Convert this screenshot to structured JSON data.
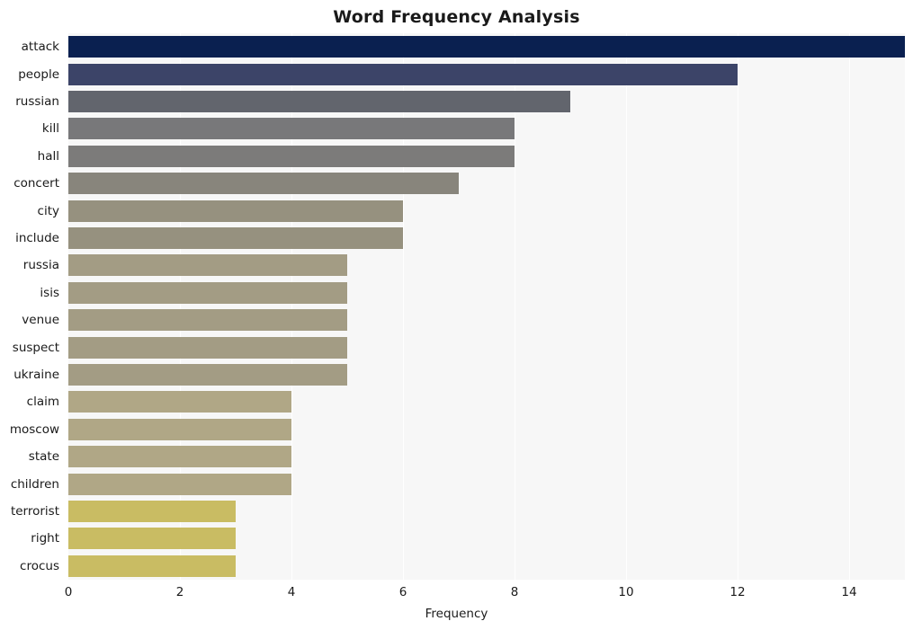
{
  "chart_data": {
    "type": "bar",
    "orientation": "horizontal",
    "title": "Word Frequency Analysis",
    "xlabel": "Frequency",
    "ylabel": "",
    "xlim": [
      0,
      15
    ],
    "xticks": [
      0,
      2,
      4,
      6,
      8,
      10,
      12,
      14
    ],
    "grid": "vertical-only",
    "legend": null,
    "categories": [
      "attack",
      "people",
      "russian",
      "kill",
      "hall",
      "concert",
      "city",
      "include",
      "russia",
      "isis",
      "venue",
      "suspect",
      "ukraine",
      "claim",
      "moscow",
      "state",
      "children",
      "terrorist",
      "right",
      "crocus"
    ],
    "values": [
      15,
      12,
      9,
      8,
      8,
      7,
      6,
      6,
      5,
      5,
      5,
      5,
      5,
      4,
      4,
      4,
      4,
      3,
      3,
      3
    ],
    "bar_colors": [
      "#0a2050",
      "#3c4468",
      "#62656d",
      "#78787a",
      "#7c7b7a",
      "#88857c",
      "#96917f",
      "#96917f",
      "#a39c84",
      "#a39c84",
      "#a39c84",
      "#a39c84",
      "#a39c84",
      "#b0a786",
      "#b0a786",
      "#b0a786",
      "#b0a786",
      "#c9bc63",
      "#c9bc63",
      "#c9bc63"
    ],
    "plot_background": "#f7f7f7",
    "gridline_color": "#ffffff"
  }
}
